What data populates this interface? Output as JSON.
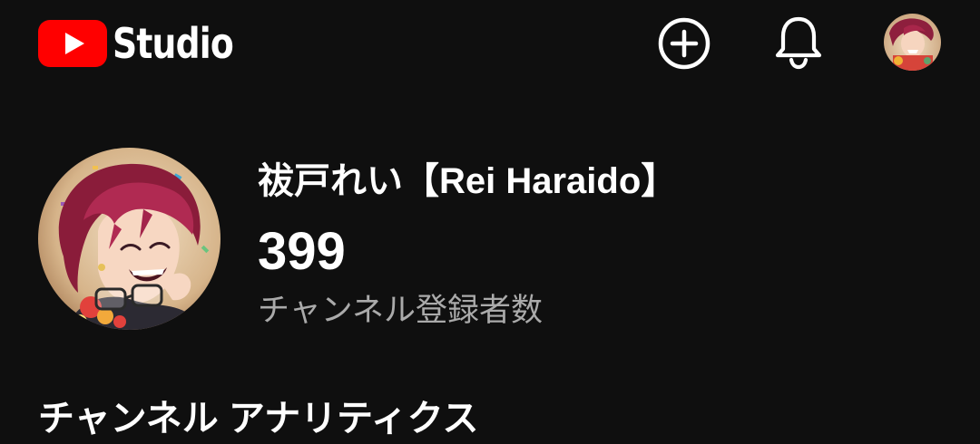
{
  "app": {
    "logo_text": "Studio",
    "brand_color": "#ff0000",
    "background": "#0f0f0f"
  },
  "header": {
    "create_icon": "add-circle-icon",
    "notifications_icon": "bell-icon",
    "account_icon": "avatar"
  },
  "channel": {
    "name": "祓戸れい【Rei Haraido】",
    "subscriber_count": "399",
    "subscriber_label": "チャンネル登録者数"
  },
  "section": {
    "title": "チャンネル アナリティクス"
  }
}
